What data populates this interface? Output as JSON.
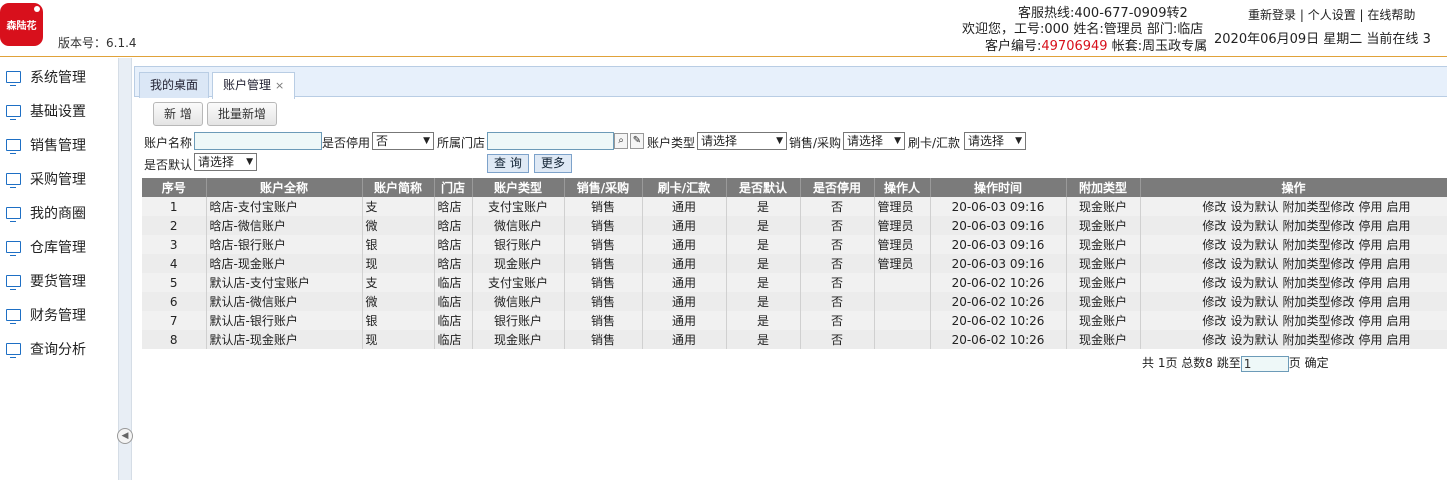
{
  "header": {
    "logo_text": "森陆花",
    "version": "版本号：6.1.4",
    "hotline": "客服热线:400-677-0909转2",
    "welcome": "欢迎您，工号:000 姓名:管理员 部门:临店",
    "cust_prefix": "客户编号:",
    "cust_id": "49706949",
    "account_set": " 帐套:周玉政专属",
    "links": [
      "重新登录",
      "个人设置",
      "在线帮助"
    ],
    "link_sep": " | ",
    "date_line": "2020年06月09日 星期二 当前在线 3"
  },
  "sidebar": {
    "items": [
      {
        "label": "系统管理"
      },
      {
        "label": "基础设置"
      },
      {
        "label": "销售管理"
      },
      {
        "label": "采购管理"
      },
      {
        "label": "我的商圈"
      },
      {
        "label": "仓库管理"
      },
      {
        "label": "要货管理"
      },
      {
        "label": "财务管理"
      },
      {
        "label": "查询分析"
      }
    ],
    "collapse_glyph": "◀"
  },
  "tabs": [
    {
      "label": "我的桌面"
    },
    {
      "label": "账户管理",
      "close": "×"
    }
  ],
  "toolbar": {
    "add_label": "新 增",
    "batch_add_label": "批量新增"
  },
  "filters": {
    "account_name_label": "账户名称",
    "account_name_value": "",
    "disabled_label": "是否停用",
    "disabled_value": "否",
    "store_label": "所属门店",
    "store_value": "",
    "account_type_label": "账户类型",
    "account_type_value": "请选择",
    "sale_purchase_label": "销售/采购",
    "sale_purchase_value": "请选择",
    "card_remit_label": "刷卡/汇款",
    "card_remit_value": "请选择",
    "default_label": "是否默认",
    "default_value": "请选择",
    "query_label": "查 询",
    "more_label": "更多"
  },
  "table": {
    "columns": [
      "序号",
      "账户全称",
      "账户简称",
      "门店",
      "账户类型",
      "销售/采购",
      "刷卡/汇款",
      "是否默认",
      "是否停用",
      "操作人",
      "操作时间",
      "附加类型",
      "操作"
    ],
    "actions": [
      "修改",
      "设为默认",
      "附加类型修改",
      "停用",
      "启用"
    ],
    "rows": [
      [
        "1",
        "晗店-支付宝账户",
        "支",
        "晗店",
        "支付宝账户",
        "销售",
        "通用",
        "是",
        "否",
        "管理员",
        "20-06-03 09:16",
        "现金账户"
      ],
      [
        "2",
        "晗店-微信账户",
        "微",
        "晗店",
        "微信账户",
        "销售",
        "通用",
        "是",
        "否",
        "管理员",
        "20-06-03 09:16",
        "现金账户"
      ],
      [
        "3",
        "晗店-银行账户",
        "银",
        "晗店",
        "银行账户",
        "销售",
        "通用",
        "是",
        "否",
        "管理员",
        "20-06-03 09:16",
        "现金账户"
      ],
      [
        "4",
        "晗店-现金账户",
        "现",
        "晗店",
        "现金账户",
        "销售",
        "通用",
        "是",
        "否",
        "管理员",
        "20-06-03 09:16",
        "现金账户"
      ],
      [
        "5",
        "默认店-支付宝账户",
        "支",
        "临店",
        "支付宝账户",
        "销售",
        "通用",
        "是",
        "否",
        "",
        "20-06-02 10:26",
        "现金账户"
      ],
      [
        "6",
        "默认店-微信账户",
        "微",
        "临店",
        "微信账户",
        "销售",
        "通用",
        "是",
        "否",
        "",
        "20-06-02 10:26",
        "现金账户"
      ],
      [
        "7",
        "默认店-银行账户",
        "银",
        "临店",
        "银行账户",
        "销售",
        "通用",
        "是",
        "否",
        "",
        "20-06-02 10:26",
        "现金账户"
      ],
      [
        "8",
        "默认店-现金账户",
        "现",
        "临店",
        "现金账户",
        "销售",
        "通用",
        "是",
        "否",
        "",
        "20-06-02 10:26",
        "现金账户"
      ]
    ]
  },
  "pager": {
    "summary": "共 1页 总数8 跳至",
    "page_value": "1",
    "page_suffix": "页",
    "confirm": "确定"
  }
}
